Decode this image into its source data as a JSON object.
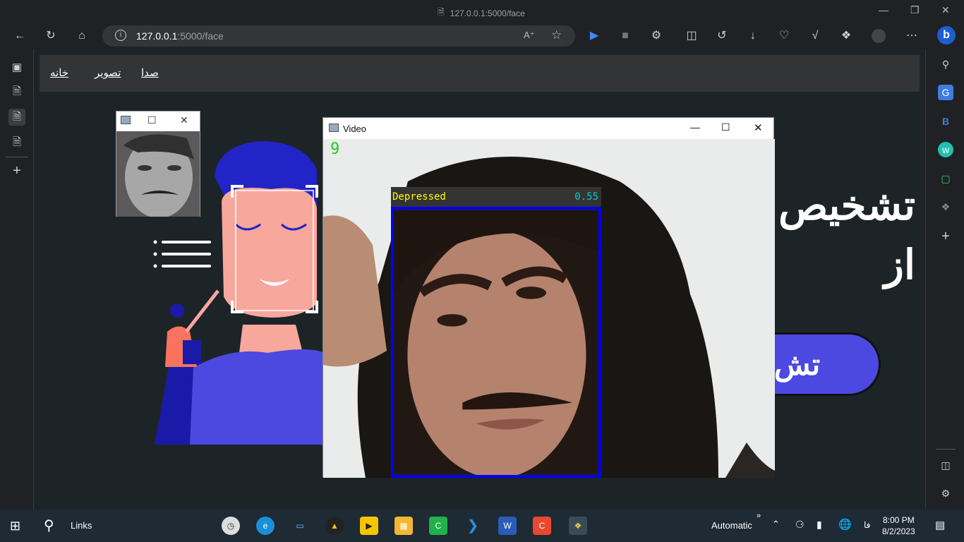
{
  "browser": {
    "tab_title": "127.0.0.1:5000/face",
    "url_host": "127.0.0.1",
    "url_path": ":5000/face"
  },
  "nav": {
    "items": [
      {
        "label": "خانه"
      },
      {
        "label": "تصویر"
      },
      {
        "label": "صدا"
      }
    ]
  },
  "hero": {
    "title_line1": "تشخیص",
    "title_line2": "از",
    "button_label": "تش"
  },
  "video_window": {
    "title": "Video",
    "frame_counter": "9",
    "emotion_label": "Depressed",
    "confidence": "0.55",
    "box_color": "#0000ff",
    "label_color": "#ffff00",
    "confidence_color": "#00cccc"
  },
  "taskbar": {
    "search_label": "Links",
    "status": "Automatic",
    "language": "فا",
    "time": "8:00 PM",
    "date": "8/2/2023"
  },
  "colors": {
    "page_bg": "#1d2427",
    "nav_bg": "#333436",
    "accent_button": "#4b49e0"
  }
}
